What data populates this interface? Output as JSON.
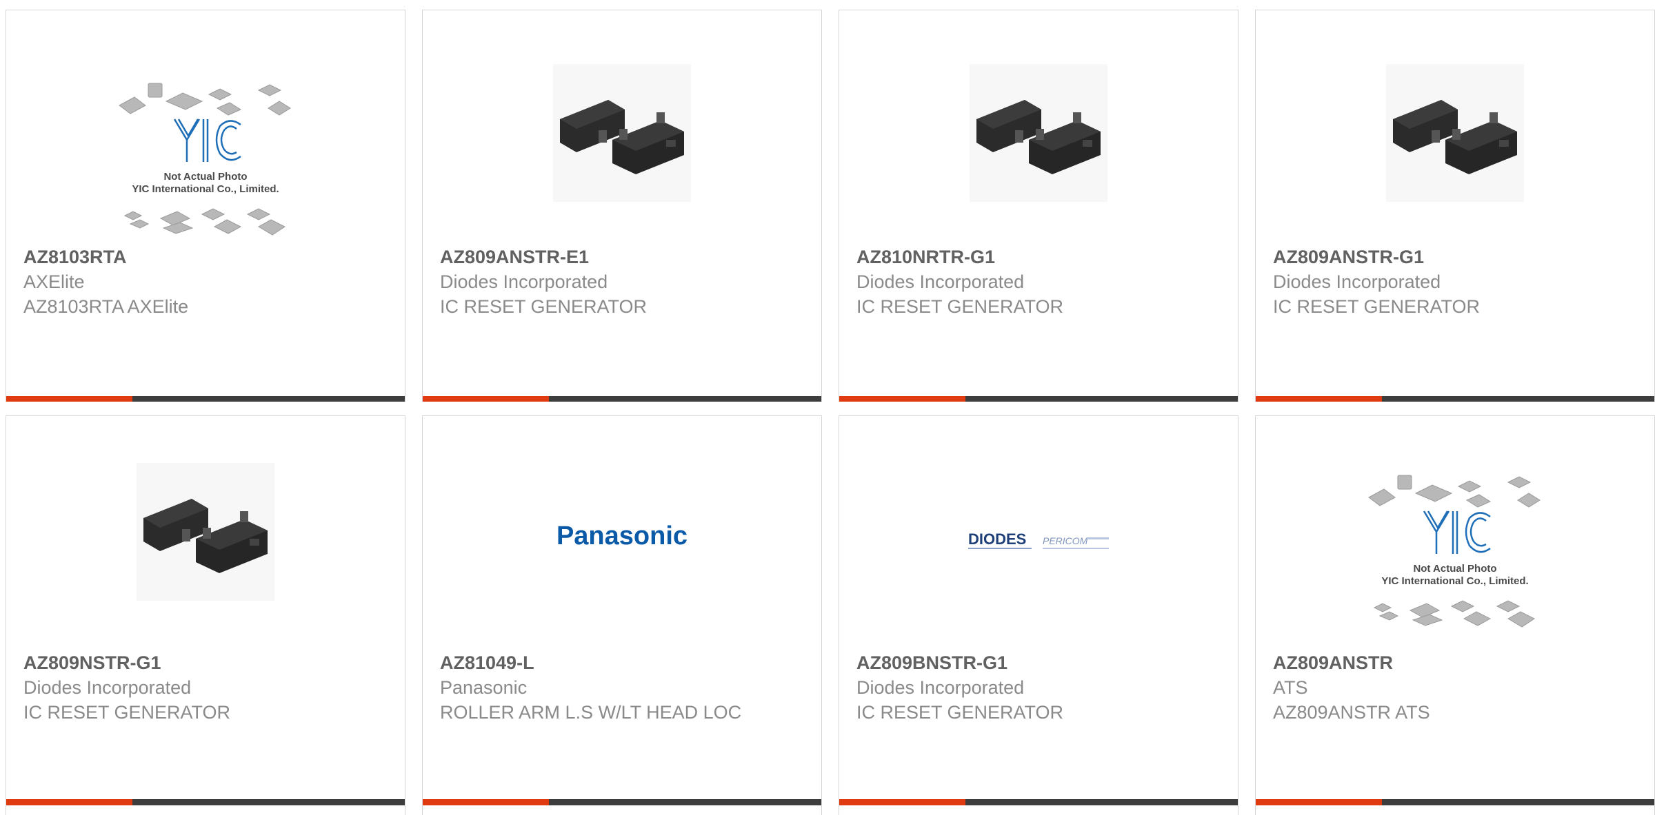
{
  "colors": {
    "accent_bar": "#e03a10",
    "dark_bar": "#3d3d3d",
    "border": "#d6d6d6"
  },
  "products": [
    {
      "part": "AZ8103RTA",
      "manufacturer": "AXElite",
      "description": "AZ8103RTA AXElite",
      "image": "not-actual-photo-placeholder",
      "image_text": {
        "logo": "YIC",
        "line1": "Not Actual Photo",
        "line2": "YIC International Co., Limited."
      }
    },
    {
      "part": "AZ809ANSTR-E1",
      "manufacturer": "Diodes Incorporated",
      "description": "IC RESET GENERATOR",
      "image": "sot23-package-photo"
    },
    {
      "part": "AZ810NRTR-G1",
      "manufacturer": "Diodes Incorporated",
      "description": "IC RESET GENERATOR",
      "image": "sot23-package-photo"
    },
    {
      "part": "AZ809ANSTR-G1",
      "manufacturer": "Diodes Incorporated",
      "description": "IC RESET GENERATOR",
      "image": "sot23-package-photo"
    },
    {
      "part": "AZ809NSTR-G1",
      "manufacturer": "Diodes Incorporated",
      "description": "IC RESET GENERATOR",
      "image": "sot23-package-photo"
    },
    {
      "part": "AZ81049-L",
      "manufacturer": "Panasonic",
      "description": "ROLLER ARM L.S W/LT HEAD LOC",
      "image": "panasonic-logo",
      "image_text": {
        "logo": "Panasonic"
      }
    },
    {
      "part": "AZ809BNSTR-G1",
      "manufacturer": "Diodes Incorporated",
      "description": "IC RESET GENERATOR",
      "image": "diodes-pericom-logo",
      "image_text": {
        "logo1": "DIODES",
        "logo2": "PERICOM"
      }
    },
    {
      "part": "AZ809ANSTR",
      "manufacturer": "ATS",
      "description": "AZ809ANSTR ATS",
      "image": "not-actual-photo-placeholder",
      "image_text": {
        "logo": "YIC",
        "line1": "Not Actual Photo",
        "line2": "YIC International Co., Limited."
      }
    }
  ]
}
